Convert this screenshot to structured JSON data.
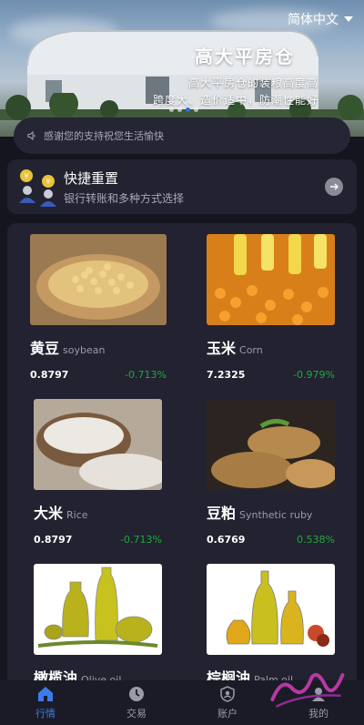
{
  "banner": {
    "title": "高大平房仓",
    "line1": "高大平房仓的装粮高度高",
    "line2": "跨度大、造价适中，防潮性能好"
  },
  "language": {
    "label": "简体中文"
  },
  "notice": {
    "text": "感谢您的支持祝您生活愉快"
  },
  "quick": {
    "title": "快捷重置",
    "subtitle": "银行转账和多种方式选择"
  },
  "products": [
    {
      "cn": "黄豆",
      "en": "soybean",
      "price": "0.8797",
      "change": "-0.713%"
    },
    {
      "cn": "玉米",
      "en": "Corn",
      "price": "7.2325",
      "change": "-0.979%"
    },
    {
      "cn": "大米",
      "en": "Rice",
      "price": "0.8797",
      "change": "-0.713%"
    },
    {
      "cn": "豆粕",
      "en": "Synthetic ruby",
      "price": "0.6769",
      "change": "0.538%"
    },
    {
      "cn": "橄榄油",
      "en": "Olive oil",
      "price": "",
      "change": ""
    },
    {
      "cn": "棕榈油",
      "en": "Palm oil",
      "price": "",
      "change": ""
    }
  ],
  "tabs": [
    {
      "label": "行情",
      "icon": "home-icon",
      "active": true
    },
    {
      "label": "交易",
      "icon": "clock-icon",
      "active": false
    },
    {
      "label": "账户",
      "icon": "account-icon",
      "active": false
    },
    {
      "label": "我的",
      "icon": "user-icon",
      "active": false
    }
  ],
  "colors": {
    "accent": "#3b7bea",
    "up": "#1faa3a",
    "bg": "#15151f",
    "card": "#222230"
  }
}
